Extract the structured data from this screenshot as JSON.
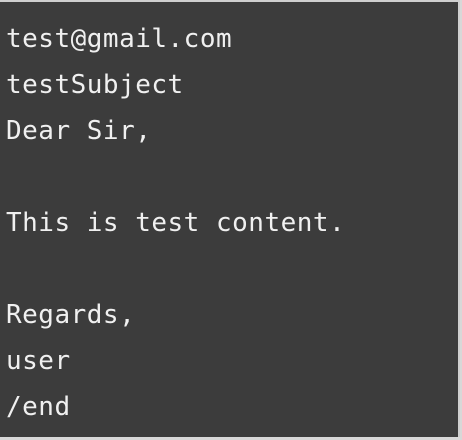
{
  "console": {
    "lines": [
      "test@gmail.com",
      "testSubject",
      "Dear Sir,",
      "",
      "This is test content.",
      "",
      "Regards,",
      "user",
      "/end"
    ]
  }
}
